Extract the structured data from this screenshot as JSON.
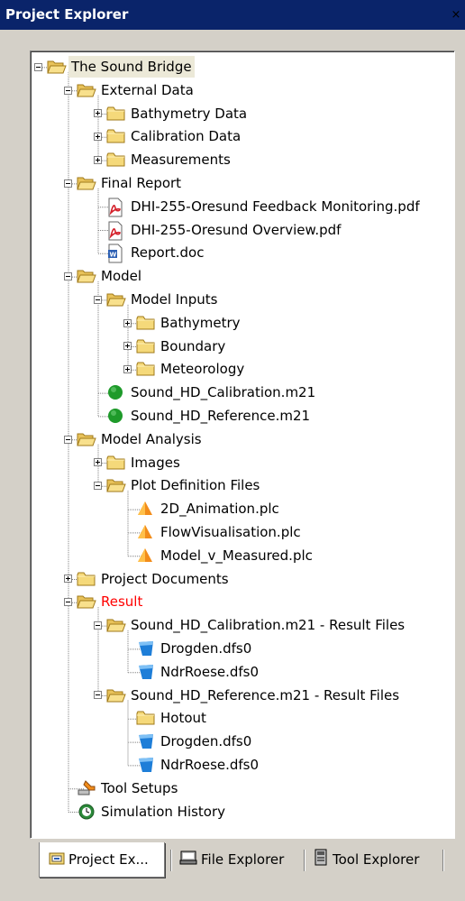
{
  "window": {
    "title": "Project Explorer",
    "close_glyph": "×"
  },
  "tree": [
    {
      "label": "The Sound Bridge",
      "depth": 0,
      "icon": "folder-open-icon",
      "expander": "minus",
      "selected": true
    },
    {
      "label": "External Data",
      "depth": 1,
      "icon": "folder-open-icon",
      "expander": "minus"
    },
    {
      "label": "Bathymetry Data",
      "depth": 2,
      "icon": "folder-icon",
      "expander": "plus"
    },
    {
      "label": "Calibration Data",
      "depth": 2,
      "icon": "folder-icon",
      "expander": "plus"
    },
    {
      "label": "Measurements",
      "depth": 2,
      "icon": "folder-icon",
      "expander": "plus"
    },
    {
      "label": "Final Report",
      "depth": 1,
      "icon": "folder-open-icon",
      "expander": "minus"
    },
    {
      "label": "DHI-255-Oresund Feedback Monitoring.pdf",
      "depth": 2,
      "icon": "pdf-file-icon"
    },
    {
      "label": "DHI-255-Oresund Overview.pdf",
      "depth": 2,
      "icon": "pdf-file-icon"
    },
    {
      "label": "Report.doc",
      "depth": 2,
      "icon": "word-doc-icon"
    },
    {
      "label": "Model",
      "depth": 1,
      "icon": "folder-open-icon",
      "expander": "minus"
    },
    {
      "label": "Model Inputs",
      "depth": 2,
      "icon": "folder-open-icon",
      "expander": "minus"
    },
    {
      "label": "Bathymetry",
      "depth": 3,
      "icon": "folder-icon",
      "expander": "plus"
    },
    {
      "label": "Boundary",
      "depth": 3,
      "icon": "folder-icon",
      "expander": "plus"
    },
    {
      "label": "Meteorology",
      "depth": 3,
      "icon": "folder-icon",
      "expander": "plus"
    },
    {
      "label": "Sound_HD_Calibration.m21",
      "depth": 2,
      "icon": "green-model-icon"
    },
    {
      "label": "Sound_HD_Reference.m21",
      "depth": 2,
      "icon": "green-model-icon"
    },
    {
      "label": "Model Analysis",
      "depth": 1,
      "icon": "folder-open-icon",
      "expander": "minus"
    },
    {
      "label": "Images",
      "depth": 2,
      "icon": "folder-icon",
      "expander": "plus"
    },
    {
      "label": "Plot Definition Files",
      "depth": 2,
      "icon": "folder-open-icon",
      "expander": "minus"
    },
    {
      "label": "2D_Animation.plc",
      "depth": 3,
      "icon": "plot-cone-icon"
    },
    {
      "label": "FlowVisualisation.plc",
      "depth": 3,
      "icon": "plot-cone-icon"
    },
    {
      "label": "Model_v_Measured.plc",
      "depth": 3,
      "icon": "plot-cone-icon"
    },
    {
      "label": "Project Documents",
      "depth": 1,
      "icon": "folder-icon",
      "expander": "plus"
    },
    {
      "label": "Result",
      "depth": 1,
      "icon": "folder-open-icon",
      "expander": "minus",
      "color": "#ff0000"
    },
    {
      "label": "Sound_HD_Calibration.m21 - Result Files",
      "depth": 2,
      "icon": "folder-open-icon",
      "expander": "minus"
    },
    {
      "label": "Drogden.dfs0",
      "depth": 3,
      "icon": "blue-dfs-icon"
    },
    {
      "label": "NdrRoese.dfs0",
      "depth": 3,
      "icon": "blue-dfs-icon"
    },
    {
      "label": "Sound_HD_Reference.m21 - Result Files",
      "depth": 2,
      "icon": "folder-open-icon",
      "expander": "minus"
    },
    {
      "label": "Hotout",
      "depth": 3,
      "icon": "folder-icon"
    },
    {
      "label": "Drogden.dfs0",
      "depth": 3,
      "icon": "blue-dfs-icon"
    },
    {
      "label": "NdrRoese.dfs0",
      "depth": 3,
      "icon": "blue-dfs-icon"
    },
    {
      "label": "Tool Setups",
      "depth": 1,
      "icon": "tool-wrench-icon"
    },
    {
      "label": "Simulation History",
      "depth": 1,
      "icon": "history-clock-icon"
    }
  ],
  "tabs": [
    {
      "label": "Project Ex...",
      "icon": "project-explorer-icon",
      "active": true
    },
    {
      "label": "File Explorer",
      "icon": "file-explorer-icon",
      "active": false
    },
    {
      "label": "Tool Explorer",
      "icon": "tool-explorer-icon",
      "active": false
    }
  ],
  "colors": {
    "titlebar": "#0a246a",
    "folder": "#f5d97a",
    "red_label": "#ff0000"
  }
}
